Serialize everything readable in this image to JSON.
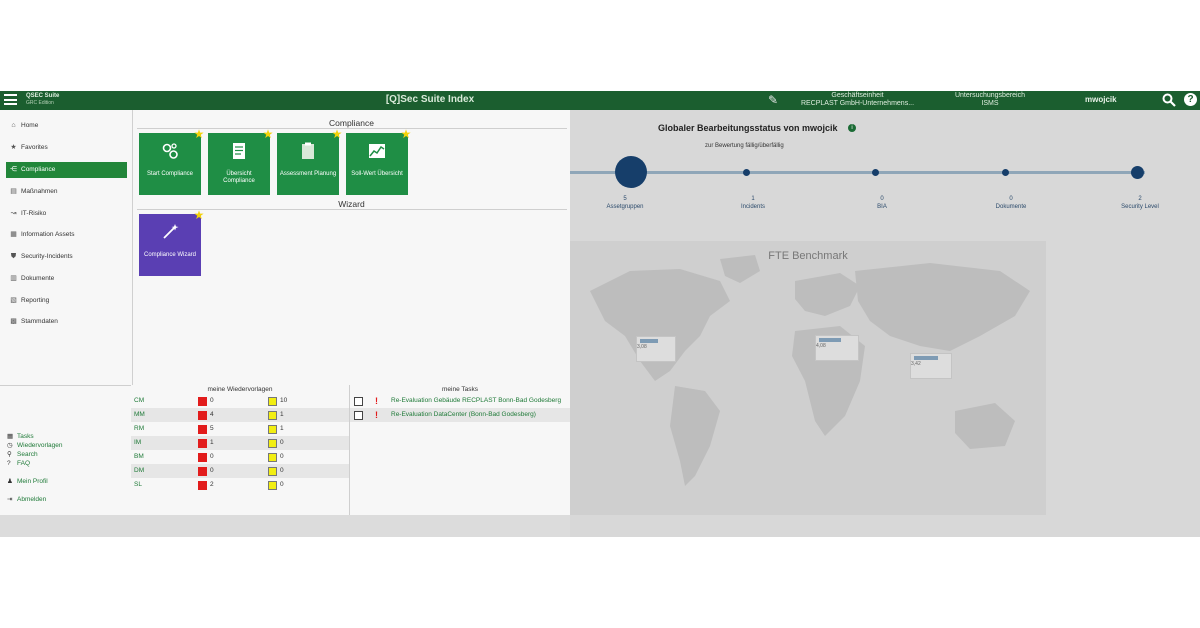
{
  "header": {
    "logo_line1": "QSEC Suite",
    "logo_line2": "GRC Edition",
    "title": "[Q]Sec Suite Index",
    "unit_label": "Geschäftseinheit",
    "unit_value": "RECPLAST GmbH-Unternehmens...",
    "area_label": "Untersuchungsbereich",
    "area_value": "ISMS",
    "user": "mwojcik",
    "help": "?"
  },
  "nav": {
    "items": [
      {
        "label": "Home",
        "icon": "home-icon",
        "glyph": "⌂"
      },
      {
        "label": "Favorites",
        "icon": "star-icon",
        "glyph": "★"
      },
      {
        "label": "Compliance",
        "icon": "share-icon",
        "glyph": "⋲"
      },
      {
        "label": "Maßnahmen",
        "icon": "document-icon",
        "glyph": "▤"
      },
      {
        "label": "IT-Risiko",
        "icon": "risk-icon",
        "glyph": "↝"
      },
      {
        "label": "Information Assets",
        "icon": "assets-icon",
        "glyph": "▦"
      },
      {
        "label": "Security-Incidents",
        "icon": "shield-icon",
        "glyph": "⛊"
      },
      {
        "label": "Dokumente",
        "icon": "file-icon",
        "glyph": "▥"
      },
      {
        "label": "Reporting",
        "icon": "report-icon",
        "glyph": "▧"
      },
      {
        "label": "Stammdaten",
        "icon": "data-icon",
        "glyph": "▩"
      }
    ],
    "active_index": 2,
    "quick": [
      {
        "label": "Tasks",
        "icon": "tasks-icon",
        "glyph": "▦"
      },
      {
        "label": "Wiedervorlagen",
        "icon": "clock-icon",
        "glyph": "◷"
      },
      {
        "label": "Search",
        "icon": "search-icon",
        "glyph": "⚲"
      },
      {
        "label": "FAQ",
        "icon": "question-icon",
        "glyph": "?"
      }
    ],
    "profile": "Mein Profil",
    "logout": "Abmelden"
  },
  "compliance": {
    "header": "Compliance",
    "tiles": [
      {
        "label": "Start Compliance",
        "icon": "gears-icon"
      },
      {
        "label": "Übersicht Compliance",
        "icon": "checklist-icon"
      },
      {
        "label": "Assessment Planung",
        "icon": "clipboard-icon"
      },
      {
        "label": "Soll-Wert Übersicht",
        "icon": "chart-icon"
      }
    ],
    "wizard_header": "Wizard",
    "wizard_tile": {
      "label": "Compliance Wizard",
      "icon": "magic-wand-icon"
    }
  },
  "templates": {
    "header": "meine Wiedervorlagen",
    "rows": [
      {
        "code": "CM",
        "red": "0",
        "yellow": "10"
      },
      {
        "code": "MM",
        "red": "4",
        "yellow": "1"
      },
      {
        "code": "RM",
        "red": "5",
        "yellow": "1"
      },
      {
        "code": "IM",
        "red": "1",
        "yellow": "0"
      },
      {
        "code": "BM",
        "red": "0",
        "yellow": "0"
      },
      {
        "code": "DM",
        "red": "0",
        "yellow": "0"
      },
      {
        "code": "SL",
        "red": "2",
        "yellow": "0"
      }
    ]
  },
  "tasks": {
    "header": "meine Tasks",
    "rows": [
      {
        "text": "Re-Evaluation Gebäude RECPLAST Bonn-Bad Godesberg"
      },
      {
        "text": "Re-Evaluation DataCenter (Bonn-Bad Godesberg)"
      }
    ]
  },
  "dashboard": {
    "title": "Globaler Bearbeitungsstatus von mwojcik",
    "subtitle": "zur Bewertung fällig/überfällig",
    "stats": [
      {
        "count": "5",
        "label": "Assetgruppen"
      },
      {
        "count": "1",
        "label": "Incidents"
      },
      {
        "count": "0",
        "label": "BIA"
      },
      {
        "count": "0",
        "label": "Dokumente"
      },
      {
        "count": "2",
        "label": "Security Level"
      }
    ],
    "benchmark_title": "FTE Benchmark",
    "map_values": [
      "3,08",
      "4,08",
      "3,42",
      "3,61",
      "3,09"
    ]
  },
  "colors": {
    "header_green": "#1b5e2f",
    "tile_green": "#1f8e45",
    "tile_purple": "#5a3fb3",
    "active_nav": "#22863a",
    "timeline_node": "#163e6a",
    "warn_red": "#e21c1c",
    "warn_yellow": "#f2ee12"
  }
}
